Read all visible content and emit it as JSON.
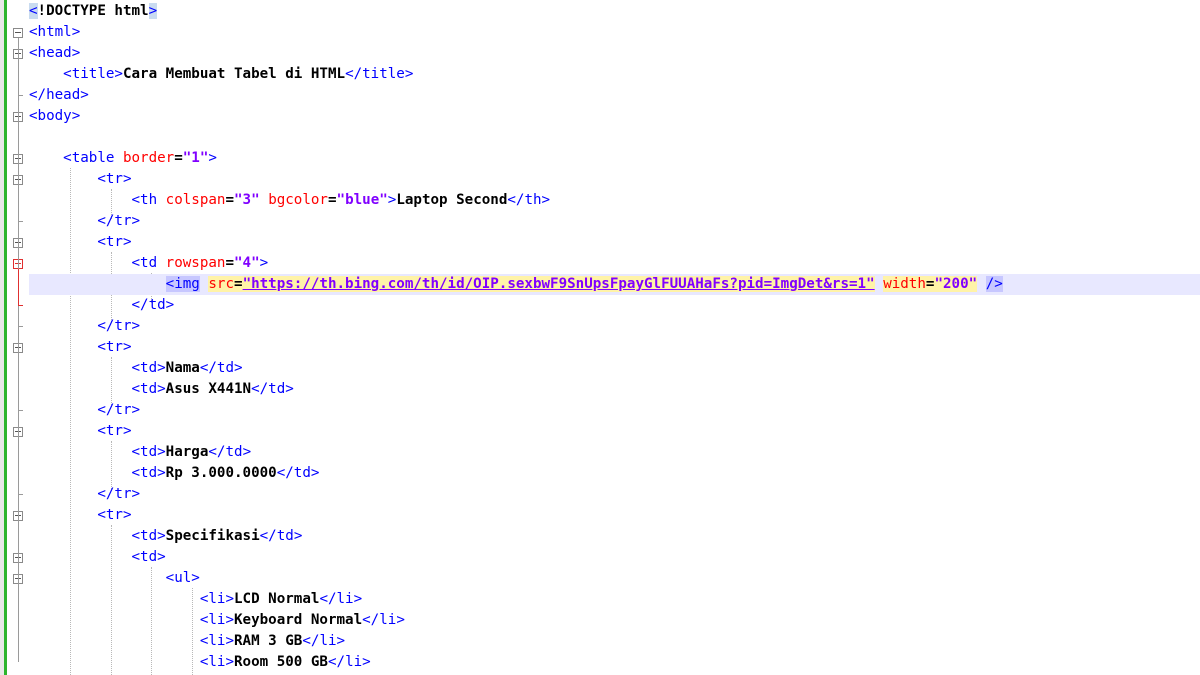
{
  "editor": {
    "lines": [
      "<!DOCTYPE html>",
      "<html>",
      "<head>",
      "<title>Cara Membuat Tabel di HTML</title>",
      "</head>",
      "<body>",
      "",
      "<table border=\"1\">",
      "<tr>",
      "<th colspan=\"3\" bgcolor=\"blue\">Laptop Second</th>",
      "</tr>",
      "<tr>",
      "<td rowspan=\"4\">",
      "<img src=\"https://th.bing.com/th/id/OIP.sexbwF9SnUpsFpayGlFUUAHaFs?pid=ImgDet&rs=1\" width=\"200\" />",
      "</td>",
      "</tr>",
      "<tr>",
      "<td>Nama</td>",
      "<td>Asus X441N</td>",
      "</tr>",
      "<tr>",
      "<td>Harga</td>",
      "<td>Rp 3.000.0000</td>",
      "</tr>",
      "<tr>",
      "<td>Specifikasi</td>",
      "<td>",
      "<ul>",
      "<li>LCD Normal</li>",
      "<li>Keyboard Normal</li>",
      "<li>RAM 3 GB</li>",
      "<li>Room 500 GB</li>"
    ],
    "current_line": 14,
    "colors": {
      "tag": "#0000ff",
      "attribute_name": "#ff0000",
      "attribute_value": "#8000ff",
      "text": "#000000",
      "change_bar": "#2db52d",
      "current_line_bg": "#e8e8ff",
      "fold_active": "#e03030"
    }
  }
}
